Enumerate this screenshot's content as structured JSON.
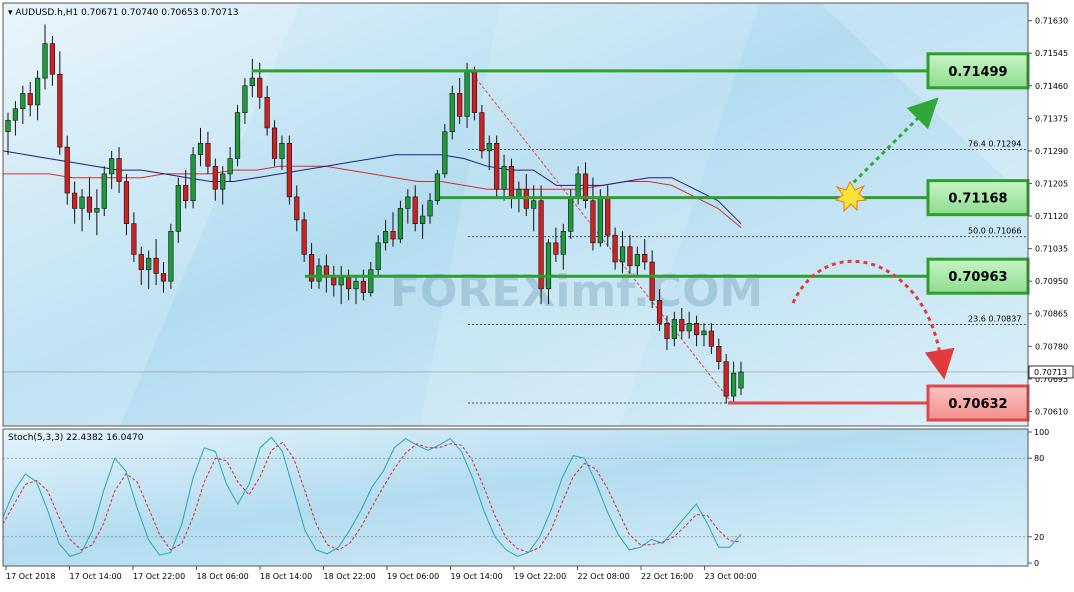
{
  "window": {
    "symbol_line": "AUDUSD.h,H1  0.70671 0.70740 0.70653 0.70713",
    "watermark": "FOREXimf.COM"
  },
  "colors": {
    "bg_top": "#d8ecf6",
    "bg_mid": "#9fd0ea",
    "bull_candle": "#1f9a3a",
    "bear_candle": "#cc2222",
    "level_green": "#2e9e2e",
    "level_green_fill": "#9be39b",
    "level_red": "#e04848",
    "level_red_fill": "#f7a3a3",
    "ma_fast": "#1a237e",
    "ma_slow": "#d32f2f",
    "stoch_main": "#26a6b5",
    "stoch_signal": "#d32f2f"
  },
  "chart_data": [
    {
      "type": "candlestick",
      "symbol": "AUDUSD.h",
      "timeframe": "H1",
      "ohlc_last": {
        "open": 0.70671,
        "high": 0.7074,
        "low": 0.70653,
        "close": 0.70713
      },
      "ylim": [
        0.70572,
        0.71676
      ],
      "y_ticks": [
        "0.71630",
        "0.71545",
        "0.71460",
        "0.71375",
        "0.71290",
        "0.71205",
        "0.71120",
        "0.71035",
        "0.70950",
        "0.70865",
        "0.70780",
        "0.70695",
        "0.70610"
      ],
      "current_price_label": "0.70713",
      "x_labels": [
        "17 Oct 2018",
        "17 Oct 14:00",
        "17 Oct 22:00",
        "18 Oct 06:00",
        "18 Oct 14:00",
        "18 Oct 22:00",
        "19 Oct 06:00",
        "19 Oct 14:00",
        "19 Oct 22:00",
        "22 Oct 08:00",
        "22 Oct 16:00",
        "23 Oct 00:00"
      ],
      "candles": [
        [
          0.7134,
          0.7139,
          0.7128,
          0.7137
        ],
        [
          0.7137,
          0.7142,
          0.7133,
          0.714
        ],
        [
          0.714,
          0.7146,
          0.7136,
          0.7144
        ],
        [
          0.7144,
          0.7147,
          0.7138,
          0.7141
        ],
        [
          0.7141,
          0.715,
          0.7137,
          0.7148
        ],
        [
          0.7148,
          0.7162,
          0.7145,
          0.7157
        ],
        [
          0.7157,
          0.7159,
          0.7146,
          0.7149
        ],
        [
          0.7149,
          0.7155,
          0.7128,
          0.713
        ],
        [
          0.713,
          0.7133,
          0.7115,
          0.7118
        ],
        [
          0.7118,
          0.7121,
          0.711,
          0.7114
        ],
        [
          0.7114,
          0.7119,
          0.7108,
          0.7117
        ],
        [
          0.7117,
          0.7122,
          0.7111,
          0.7113
        ],
        [
          0.7113,
          0.7119,
          0.7107,
          0.7114
        ],
        [
          0.7114,
          0.7125,
          0.7112,
          0.7123
        ],
        [
          0.7123,
          0.7129,
          0.7119,
          0.7127
        ],
        [
          0.7127,
          0.713,
          0.7118,
          0.7121
        ],
        [
          0.7121,
          0.7123,
          0.7107,
          0.711
        ],
        [
          0.711,
          0.7113,
          0.71,
          0.7102
        ],
        [
          0.7102,
          0.7104,
          0.7094,
          0.7098
        ],
        [
          0.7098,
          0.7103,
          0.7093,
          0.7101
        ],
        [
          0.7101,
          0.7106,
          0.7094,
          0.7097
        ],
        [
          0.7097,
          0.71,
          0.7092,
          0.7095
        ],
        [
          0.7095,
          0.711,
          0.7093,
          0.7108
        ],
        [
          0.7108,
          0.7122,
          0.7105,
          0.712
        ],
        [
          0.712,
          0.7124,
          0.7114,
          0.7116
        ],
        [
          0.7116,
          0.713,
          0.7114,
          0.7128
        ],
        [
          0.7128,
          0.7135,
          0.7125,
          0.7131
        ],
        [
          0.7131,
          0.7134,
          0.7123,
          0.7125
        ],
        [
          0.7125,
          0.7127,
          0.7116,
          0.7119
        ],
        [
          0.7119,
          0.7125,
          0.7115,
          0.7123
        ],
        [
          0.7123,
          0.713,
          0.7121,
          0.7127
        ],
        [
          0.7127,
          0.7141,
          0.7125,
          0.7139
        ],
        [
          0.7139,
          0.7148,
          0.7136,
          0.7146
        ],
        [
          0.7146,
          0.7153,
          0.7143,
          0.7148
        ],
        [
          0.7148,
          0.7152,
          0.714,
          0.7143
        ],
        [
          0.7143,
          0.7146,
          0.7133,
          0.7135
        ],
        [
          0.7135,
          0.7137,
          0.7125,
          0.7127
        ],
        [
          0.7127,
          0.7133,
          0.7124,
          0.7131
        ],
        [
          0.7131,
          0.7133,
          0.7115,
          0.7117
        ],
        [
          0.7117,
          0.712,
          0.7108,
          0.7111
        ],
        [
          0.7111,
          0.7113,
          0.71,
          0.7102
        ],
        [
          0.7102,
          0.7105,
          0.7093,
          0.7095
        ],
        [
          0.7095,
          0.7101,
          0.7093,
          0.7099
        ],
        [
          0.7099,
          0.7102,
          0.7092,
          0.7096
        ],
        [
          0.7096,
          0.7099,
          0.7091,
          0.7094
        ],
        [
          0.7094,
          0.7099,
          0.7089,
          0.7096
        ],
        [
          0.7096,
          0.7098,
          0.709,
          0.7093
        ],
        [
          0.7093,
          0.7096,
          0.7089,
          0.7095
        ],
        [
          0.7095,
          0.7098,
          0.709,
          0.7092
        ],
        [
          0.7092,
          0.71,
          0.7091,
          0.7098
        ],
        [
          0.7098,
          0.7107,
          0.7096,
          0.7105
        ],
        [
          0.7105,
          0.7111,
          0.7103,
          0.7108
        ],
        [
          0.7108,
          0.7113,
          0.7104,
          0.7106
        ],
        [
          0.7106,
          0.7116,
          0.7105,
          0.7114
        ],
        [
          0.7114,
          0.7119,
          0.711,
          0.7117
        ],
        [
          0.7117,
          0.712,
          0.7108,
          0.711
        ],
        [
          0.711,
          0.7115,
          0.7106,
          0.7112
        ],
        [
          0.7112,
          0.7118,
          0.711,
          0.7116
        ],
        [
          0.7116,
          0.7124,
          0.7115,
          0.7123
        ],
        [
          0.7123,
          0.7136,
          0.7122,
          0.7134
        ],
        [
          0.7134,
          0.7146,
          0.7132,
          0.7144
        ],
        [
          0.7144,
          0.7148,
          0.7136,
          0.7138
        ],
        [
          0.7138,
          0.7152,
          0.7135,
          0.715
        ],
        [
          0.715,
          0.7151,
          0.7137,
          0.7139
        ],
        [
          0.7139,
          0.7141,
          0.7127,
          0.7129
        ],
        [
          0.7129,
          0.7133,
          0.7124,
          0.7131
        ],
        [
          0.7131,
          0.7133,
          0.7117,
          0.7119
        ],
        [
          0.7119,
          0.7128,
          0.7116,
          0.7125
        ],
        [
          0.7125,
          0.7127,
          0.7114,
          0.7117
        ],
        [
          0.7117,
          0.7121,
          0.7113,
          0.7119
        ],
        [
          0.7119,
          0.7123,
          0.7112,
          0.7114
        ],
        [
          0.7114,
          0.712,
          0.7108,
          0.7116
        ],
        [
          0.7116,
          0.712,
          0.7089,
          0.7093
        ],
        [
          0.7093,
          0.7106,
          0.7089,
          0.7105
        ],
        [
          0.7105,
          0.7109,
          0.71,
          0.7102
        ],
        [
          0.7102,
          0.711,
          0.7098,
          0.7108
        ],
        [
          0.7108,
          0.7119,
          0.7106,
          0.7117
        ],
        [
          0.7117,
          0.7125,
          0.7115,
          0.7123
        ],
        [
          0.7123,
          0.7126,
          0.7114,
          0.7116
        ],
        [
          0.7116,
          0.7122,
          0.7103,
          0.7105
        ],
        [
          0.7105,
          0.7119,
          0.7104,
          0.7117
        ],
        [
          0.7117,
          0.712,
          0.7104,
          0.7107
        ],
        [
          0.7107,
          0.7109,
          0.7098,
          0.71
        ],
        [
          0.71,
          0.7108,
          0.7097,
          0.7104
        ],
        [
          0.7104,
          0.7107,
          0.7097,
          0.7099
        ],
        [
          0.7099,
          0.7104,
          0.7096,
          0.7102
        ],
        [
          0.7102,
          0.7106,
          0.7098,
          0.71
        ],
        [
          0.71,
          0.7103,
          0.7088,
          0.709
        ],
        [
          0.709,
          0.7093,
          0.7082,
          0.7084
        ],
        [
          0.7084,
          0.7086,
          0.7077,
          0.708
        ],
        [
          0.708,
          0.7087,
          0.7078,
          0.7085
        ],
        [
          0.7085,
          0.7088,
          0.708,
          0.7082
        ],
        [
          0.7082,
          0.7087,
          0.708,
          0.7084
        ],
        [
          0.7084,
          0.7086,
          0.7078,
          0.7081
        ],
        [
          0.7081,
          0.7084,
          0.7078,
          0.7082
        ],
        [
          0.7082,
          0.7084,
          0.7076,
          0.7078
        ],
        [
          0.7078,
          0.708,
          0.7072,
          0.7074
        ],
        [
          0.7074,
          0.7076,
          0.7063,
          0.7065
        ],
        [
          0.7065,
          0.7074,
          0.7063,
          0.7071
        ],
        [
          0.70671,
          0.7074,
          0.70653,
          0.70713
        ]
      ],
      "ma_fast": [
        0.7129,
        0.7128,
        0.7127,
        0.7126,
        0.7125,
        0.7124,
        0.7124,
        0.7123,
        0.7122,
        0.7121,
        0.7121,
        0.7122,
        0.7123,
        0.7124,
        0.7125,
        0.7126,
        0.7127,
        0.7128,
        0.7128,
        0.7128,
        0.7127,
        0.7125,
        0.7124,
        0.7124,
        0.712,
        0.712,
        0.712,
        0.7121,
        0.7122,
        0.7122,
        0.7119,
        0.7116,
        0.711
      ],
      "ma_slow": [
        0.7123,
        0.7123,
        0.7123,
        0.7122,
        0.7122,
        0.7122,
        0.7122,
        0.7123,
        0.7123,
        0.7123,
        0.7124,
        0.7124,
        0.7125,
        0.7125,
        0.7125,
        0.7124,
        0.7123,
        0.7122,
        0.7121,
        0.7121,
        0.712,
        0.7119,
        0.7119,
        0.7119,
        0.7119,
        0.7119,
        0.712,
        0.7121,
        0.7121,
        0.712,
        0.7117,
        0.7114,
        0.7109
      ],
      "levels": [
        {
          "label": "0.71499",
          "value": 0.71499,
          "kind": "resistance"
        },
        {
          "label": "0.71168",
          "value": 0.71168,
          "kind": "resistance"
        },
        {
          "label": "0.70963",
          "value": 0.70963,
          "kind": "support"
        },
        {
          "label": "0.70632",
          "value": 0.70632,
          "kind": "target"
        }
      ],
      "fibonacci": [
        {
          "label": "76.4  0.71294",
          "value": 0.71294
        },
        {
          "label": "50.0  0.71066",
          "value": 0.71066
        },
        {
          "label": "23.6  0.70837",
          "value": 0.70837
        }
      ],
      "trend_line": {
        "from_value": 0.71499,
        "to_value": 0.70632
      }
    },
    {
      "type": "line",
      "title": "Stoch(5,3,3) 22.4382 16.0470",
      "ylim": [
        0,
        100
      ],
      "y_ticks": [
        "100",
        "80",
        "20",
        "0"
      ],
      "series": [
        {
          "name": "main",
          "values": [
            35,
            55,
            68,
            62,
            40,
            15,
            5,
            8,
            25,
            55,
            80,
            70,
            42,
            18,
            6,
            8,
            30,
            65,
            88,
            85,
            60,
            45,
            60,
            88,
            96,
            85,
            55,
            25,
            10,
            7,
            12,
            25,
            40,
            58,
            70,
            88,
            95,
            90,
            86,
            90,
            95,
            85,
            65,
            40,
            20,
            10,
            5,
            8,
            20,
            40,
            65,
            82,
            80,
            62,
            40,
            22,
            10,
            12,
            18,
            15,
            25,
            35,
            45,
            30,
            12,
            12,
            22
          ]
        },
        {
          "name": "signal",
          "values": [
            30,
            45,
            60,
            63,
            55,
            35,
            18,
            10,
            14,
            30,
            55,
            68,
            62,
            42,
            22,
            10,
            15,
            35,
            62,
            80,
            78,
            62,
            52,
            66,
            86,
            92,
            80,
            55,
            30,
            14,
            10,
            15,
            27,
            43,
            58,
            72,
            84,
            91,
            88,
            88,
            91,
            90,
            78,
            58,
            36,
            19,
            11,
            8,
            12,
            25,
            46,
            66,
            76,
            72,
            58,
            40,
            22,
            14,
            14,
            16,
            20,
            28,
            37,
            36,
            25,
            17,
            16
          ]
        }
      ]
    }
  ]
}
